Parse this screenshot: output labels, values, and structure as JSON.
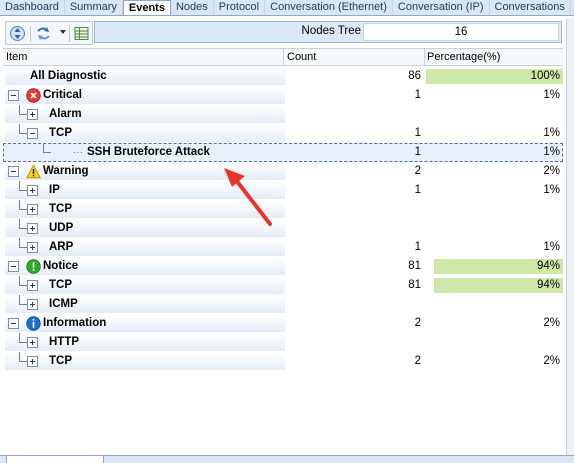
{
  "tabs": [
    {
      "label": "Dashboard",
      "active": false
    },
    {
      "label": "Summary",
      "active": false
    },
    {
      "label": "Events",
      "active": true
    },
    {
      "label": "Nodes",
      "active": false
    },
    {
      "label": "Protocol",
      "active": false
    },
    {
      "label": "Conversation (Ethernet)",
      "active": false
    },
    {
      "label": "Conversation (IP)",
      "active": false
    },
    {
      "label": "Conversations",
      "active": false
    }
  ],
  "toolbar": {
    "icons": [
      "expand-collapse-icon",
      "refresh-icon",
      "dropdown-arrow-icon",
      "table-view-icon"
    ]
  },
  "nodes_tree": {
    "label": "Nodes Tree",
    "count": "16"
  },
  "columns": {
    "item": "Item",
    "count": "Count",
    "percentage": "Percentage(%)"
  },
  "rows": [
    {
      "label": "All Diagnostic",
      "count": "86",
      "pct": "100%",
      "pct_value": 100,
      "level": 0,
      "expander": "none",
      "icon": ""
    },
    {
      "label": "Critical",
      "count": "1",
      "pct": "1%",
      "pct_value": 1,
      "level": 0,
      "expander": "minus",
      "icon": "critical-icon"
    },
    {
      "label": "Alarm",
      "count": "",
      "pct": "",
      "pct_value": 0,
      "level": 1,
      "expander": "plus",
      "icon": ""
    },
    {
      "label": "TCP",
      "count": "1",
      "pct": "1%",
      "pct_value": 1,
      "level": 1,
      "expander": "minus",
      "icon": ""
    },
    {
      "label": "SSH Bruteforce Attack",
      "count": "1",
      "pct": "1%",
      "pct_value": 1,
      "level": 2,
      "expander": "none",
      "icon": "",
      "selected": true
    },
    {
      "label": "Warning",
      "count": "2",
      "pct": "2%",
      "pct_value": 2,
      "level": 0,
      "expander": "minus",
      "icon": "warning-icon"
    },
    {
      "label": "IP",
      "count": "1",
      "pct": "1%",
      "pct_value": 1,
      "level": 1,
      "expander": "plus",
      "icon": ""
    },
    {
      "label": "TCP",
      "count": "",
      "pct": "",
      "pct_value": 0,
      "level": 1,
      "expander": "plus",
      "icon": ""
    },
    {
      "label": "UDP",
      "count": "",
      "pct": "",
      "pct_value": 0,
      "level": 1,
      "expander": "plus",
      "icon": ""
    },
    {
      "label": "ARP",
      "count": "1",
      "pct": "1%",
      "pct_value": 1,
      "level": 1,
      "expander": "plus",
      "icon": ""
    },
    {
      "label": "Notice",
      "count": "81",
      "pct": "94%",
      "pct_value": 94,
      "level": 0,
      "expander": "minus",
      "icon": "notice-icon"
    },
    {
      "label": "TCP",
      "count": "81",
      "pct": "94%",
      "pct_value": 94,
      "level": 1,
      "expander": "plus",
      "icon": ""
    },
    {
      "label": "ICMP",
      "count": "",
      "pct": "",
      "pct_value": 0,
      "level": 1,
      "expander": "plus",
      "icon": ""
    },
    {
      "label": "Information",
      "count": "2",
      "pct": "2%",
      "pct_value": 2,
      "level": 0,
      "expander": "minus",
      "icon": "information-icon"
    },
    {
      "label": "HTTP",
      "count": "",
      "pct": "",
      "pct_value": 0,
      "level": 1,
      "expander": "plus",
      "icon": ""
    },
    {
      "label": "TCP",
      "count": "2",
      "pct": "2%",
      "pct_value": 2,
      "level": 1,
      "expander": "plus",
      "icon": ""
    }
  ],
  "colors": {
    "pct_bar": "#cde8a8",
    "critical": "#e53935",
    "warning": "#f2c200",
    "notice": "#2eaa2e",
    "information": "#1f6fd1",
    "annotation_arrow": "#e8342a"
  }
}
